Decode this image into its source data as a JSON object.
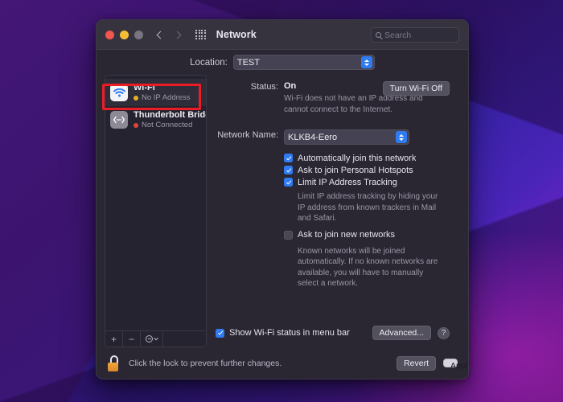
{
  "window": {
    "title": "Network",
    "traffic_lights": [
      "close",
      "minimize",
      "zoom"
    ],
    "nav": {
      "back": "back-chevron",
      "forward": "forward-chevron"
    },
    "grid_icon": "all-preferences-grid-icon",
    "search": {
      "placeholder": "Search",
      "value": "",
      "icon": "search-icon"
    }
  },
  "location": {
    "label": "Location:",
    "value": "TEST"
  },
  "sidebar": {
    "services": [
      {
        "name": "Wi-Fi",
        "status": "No IP Address",
        "status_color": "#e6b022",
        "icon": "wifi-icon",
        "selected": true,
        "highlighted": true
      },
      {
        "name": "Thunderbolt Bridge",
        "status": "Not Connected",
        "status_color": "#e0453c",
        "icon": "thunderbolt-bridge-icon",
        "selected": false,
        "highlighted": false
      }
    ],
    "footer": {
      "add": "+",
      "remove": "−",
      "actions": "gear-actions-menu"
    }
  },
  "detail": {
    "status_label": "Status:",
    "status_value": "On",
    "turn_off_button": "Turn Wi-Fi Off",
    "status_help": "Wi-Fi does not have an IP address and cannot connect to the Internet.",
    "network_name_label": "Network Name:",
    "network_name_value": "KLKB4-Eero",
    "checkboxes": [
      {
        "label": "Automatically join this network",
        "checked": true
      },
      {
        "label": "Ask to join Personal Hotspots",
        "checked": true
      },
      {
        "label": "Limit IP Address Tracking",
        "checked": true
      }
    ],
    "limit_ip_help": "Limit IP address tracking by hiding your IP address from known trackers in Mail and Safari.",
    "ask_new_networks": {
      "label": "Ask to join new networks",
      "checked": false
    },
    "ask_new_networks_help": "Known networks will be joined automatically. If no known networks are available, you will have to manually select a network.",
    "show_status": {
      "label": "Show Wi-Fi status in menu bar",
      "checked": true
    },
    "advanced_button": "Advanced...",
    "help_button": "?"
  },
  "footer": {
    "lock_icon": "unlocked-padlock-icon",
    "lock_text": "Click the lock to prevent further changes.",
    "revert_button": "Revert",
    "apply_button": "Apply"
  },
  "colors": {
    "accent_blue": "#2f7bf2",
    "annotation_red": "#ec1c24",
    "warning_amber": "#e6b022",
    "error_red": "#e0453c"
  }
}
